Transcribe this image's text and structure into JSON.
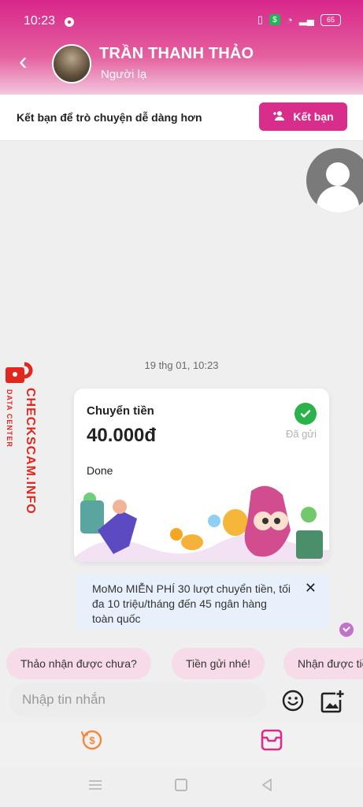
{
  "status_bar": {
    "time": "10:23",
    "battery": "65"
  },
  "header": {
    "contact_name": "TRẦN THANH THẢO",
    "contact_status": "Người lạ"
  },
  "friend_bar": {
    "prompt": "Kết bạn để trò chuyện dễ dàng hơn",
    "button_label": "Kết bạn"
  },
  "chat": {
    "date_label": "19 thg 01, 10:23",
    "transfer": {
      "title": "Chuyển tiền",
      "amount": "40.000đ",
      "note": "Done",
      "status": "Đã gửi"
    },
    "promo_text": "MoMo MIỄN PHÍ 30 lượt chuyển tiền, tối đa 10 triệu/tháng đến 45 ngân hàng toàn quốc",
    "promo_close": "✕"
  },
  "quick_replies": [
    "Thảo nhận được chưa?",
    "Tiền gửi nhé!",
    "Nhận được tiền chưa?"
  ],
  "composer": {
    "placeholder": "Nhập tin nhắn"
  },
  "watermark": {
    "text": "CHECKSCAM.INFO",
    "sub": "DATA CENTER"
  },
  "colors": {
    "brand": "#d82d8a",
    "success": "#2bb24a",
    "promo_bg": "#e8f0fb",
    "chip_bg": "#f7dbe8"
  }
}
